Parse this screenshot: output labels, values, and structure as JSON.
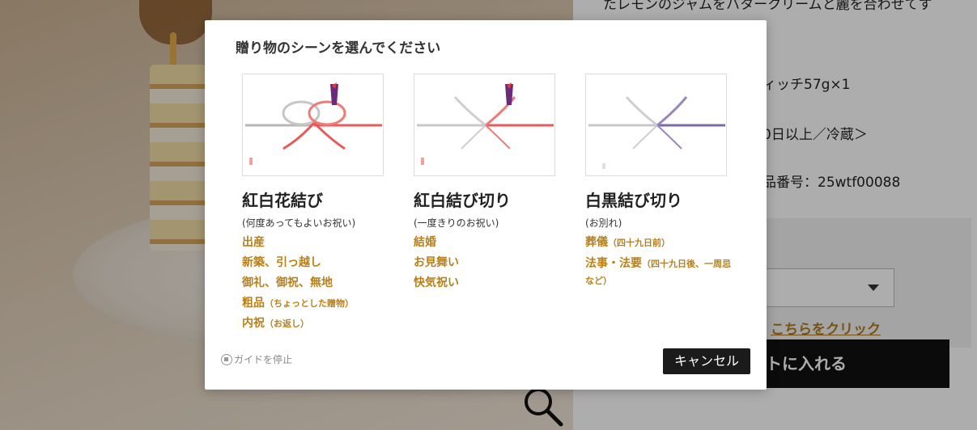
{
  "background": {
    "text_top": "たレモンのジャムをバタークリームと麗を合わせてす",
    "text_item": "ィッチ57g×1",
    "text_storage": "0日以上／冷蔵＞",
    "text_code": "品番号：25wtf00088",
    "link_text": "こちらをクリック",
    "cart_button": "トに入れる"
  },
  "modal": {
    "title": "贈り物のシーンを選んでください",
    "cards": [
      {
        "name": "紅白花結び",
        "sub": "(何度あってもよいお祝い)",
        "scenes": [
          "出産",
          "新築、引っ越し",
          "御礼、御祝、無地"
        ],
        "scene4": "粗品",
        "scene4_note": "（ちょっとした贈物）",
        "scene5": "内祝",
        "scene5_note": "（お返し）",
        "color_left": "#b7b7b7",
        "color_right": "#e85a5a"
      },
      {
        "name": "紅白結び切り",
        "sub": "(一度きりのお祝い)",
        "scenes": [
          "結婚",
          "お見舞い",
          "快気祝い"
        ],
        "color_left": "#c8c8c8",
        "color_right": "#e85a5a"
      },
      {
        "name": "白黒結び切り",
        "sub": "(お別れ)",
        "scene1": "葬儀",
        "scene1_note": "（四十九日前）",
        "scene2": "法事・法要",
        "scene2_note": "（四十九日後、一周忌など）",
        "color_left": "#c8c8c8",
        "color_right": "#7e6aa8"
      }
    ],
    "stop_guide": "ガイドを停止",
    "cancel": "キャンセル"
  }
}
